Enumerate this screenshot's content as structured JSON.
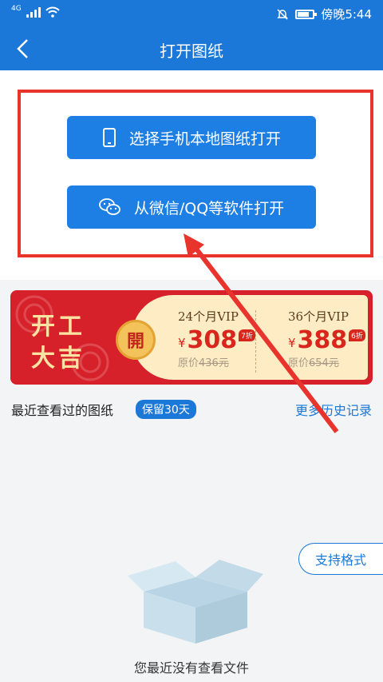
{
  "status_bar": {
    "network": "4G",
    "time": "傍晚5:44"
  },
  "nav": {
    "title": "打开图纸"
  },
  "buttons": {
    "open_local": "选择手机本地图纸打开",
    "open_wechat": "从微信/QQ等软件打开"
  },
  "banner": {
    "slogan_line1": "开工",
    "slogan_line2": "大吉",
    "seal": "開",
    "offers": [
      {
        "label": "24个月VIP",
        "currency": "¥",
        "price": "308",
        "discount": "7折",
        "orig_prefix": "原价",
        "orig_price": "436元"
      },
      {
        "label": "36个月VIP",
        "currency": "¥",
        "price": "388",
        "discount": "6折",
        "orig_prefix": "原价",
        "orig_price": "654元"
      }
    ]
  },
  "history": {
    "title": "最近查看过的图纸",
    "badge": "保留30天",
    "more_link": "更多历史记录"
  },
  "formats_button": "支持格式",
  "empty_text": "您最近没有查看文件",
  "colors": {
    "primary": "#1b78d8",
    "highlight": "#e9332d",
    "banner_red": "#d7212a"
  }
}
